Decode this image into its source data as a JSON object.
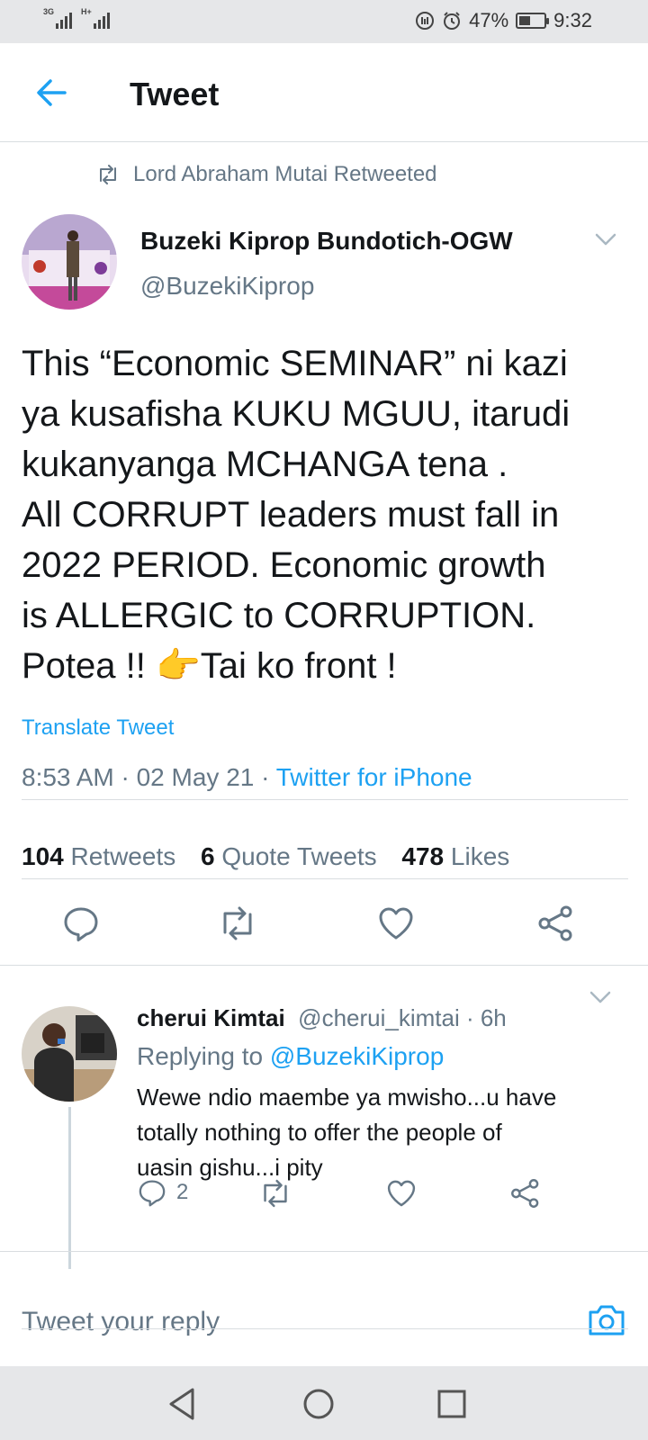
{
  "status_bar": {
    "network1": "3G",
    "network2": "H+",
    "battery_text": "47%",
    "battery_level": 0.47,
    "time": "9:32"
  },
  "header": {
    "title": "Tweet",
    "back_icon": "arrow-left-icon"
  },
  "retweet_context": {
    "text": "Lord Abraham Mutai Retweeted"
  },
  "tweet": {
    "author_name": "Buzeki Kiprop Bundotich-OGW",
    "author_handle": "@BuzekiKiprop",
    "text_lines": [
      "This “Economic SEMINAR”  ni kazi",
      "ya kusafisha KUKU MGUU,  itarudi",
      "kukanyanga  MCHANGA tena .",
      "All CORRUPT leaders must fall in",
      "2022 PERIOD. Economic growth",
      "is ALLERGIC to CORRUPTION.",
      "Potea !! 👉Tai ko front !"
    ],
    "translate_label": "Translate Tweet",
    "timestamp": "8:53 AM · 02 May 21 · ",
    "source": "Twitter for iPhone",
    "stats": {
      "retweets_count": "104",
      "retweets_label": "Retweets",
      "quotes_count": "6",
      "quotes_label": "Quote Tweets",
      "likes_count": "478",
      "likes_label": "Likes"
    }
  },
  "reply": {
    "author_name": "cherui Kimtai",
    "author_meta": "@cherui_kimtai · 6h",
    "replying_prefix": "Replying to ",
    "replying_to": "@BuzekiKiprop",
    "text_lines": [
      "Wewe ndio maembe ya mwisho...u have",
      "totally nothing to offer the people of",
      "uasin gishu...i pity"
    ],
    "reply_count": "2"
  },
  "composer": {
    "placeholder": "Tweet your reply"
  },
  "colors": {
    "accent": "#1da1f2",
    "secondary_text": "#657786",
    "divider": "#d9dde0"
  }
}
